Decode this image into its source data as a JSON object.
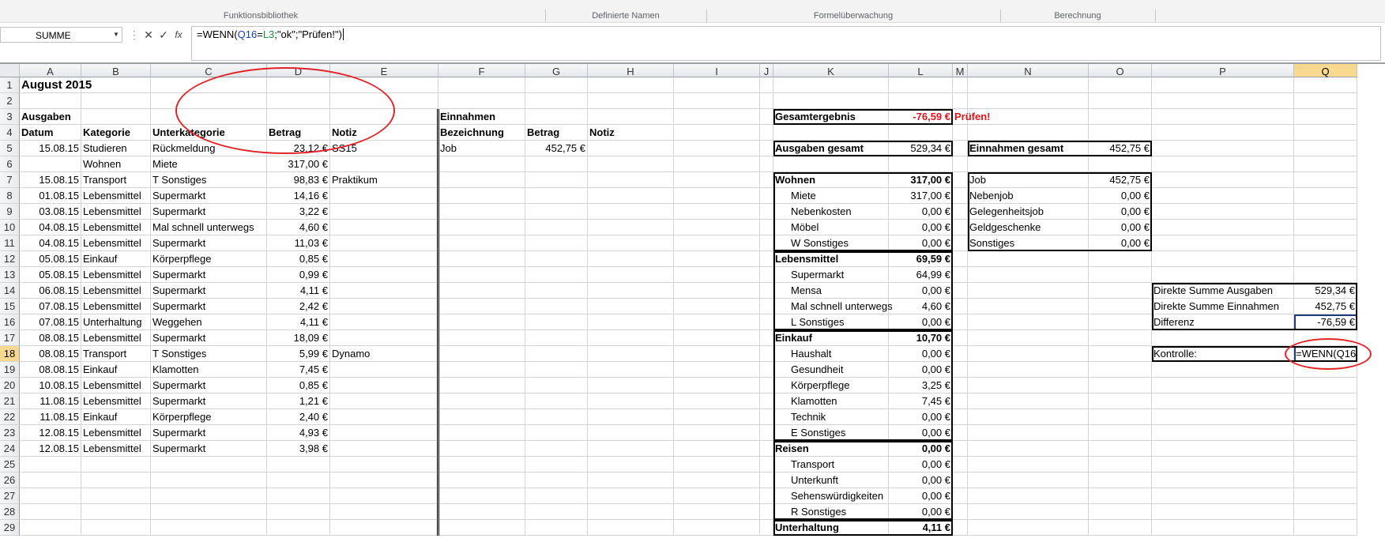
{
  "ribbon": {
    "groups": [
      "Funktionsbibliothek",
      "Definierte Namen",
      "Formelüberwachung",
      "Berechnung"
    ]
  },
  "formula_bar": {
    "name_box": "SUMME",
    "cancel_icon": "✕",
    "enter_icon": "✓",
    "fx_label": "fx",
    "formula": {
      "p1": "=WENN(",
      "ref1": "Q16",
      "eq": "=",
      "ref2": "L3",
      "p2": ";\"ok\";\"Prüfen!\")"
    }
  },
  "active_cell": "Q18",
  "columns": [
    "A",
    "B",
    "C",
    "D",
    "E",
    "F",
    "G",
    "H",
    "I",
    "J",
    "K",
    "L",
    "M",
    "N",
    "O",
    "P",
    "Q"
  ],
  "rows": [
    "1",
    "2",
    "3",
    "4",
    "5",
    "6",
    "7",
    "8",
    "9",
    "10",
    "11",
    "12",
    "13",
    "14",
    "15",
    "16",
    "17",
    "18",
    "19",
    "20",
    "21",
    "22",
    "23",
    "24",
    "25",
    "26",
    "27",
    "28",
    "29"
  ],
  "sheet": {
    "title": "August 2015",
    "expenses_title": "Ausgaben",
    "expenses_headers": [
      "Datum",
      "Kategorie",
      "Unterkategorie",
      "Betrag",
      "Notiz"
    ],
    "expenses": [
      [
        "15.08.15",
        "Studieren",
        "Rückmeldung",
        "23,12 €",
        "SS15"
      ],
      [
        "",
        "Wohnen",
        "Miete",
        "317,00 €",
        ""
      ],
      [
        "15.08.15",
        "Transport",
        "T Sonstiges",
        "98,83 €",
        "Praktikum"
      ],
      [
        "01.08.15",
        "Lebensmittel",
        "Supermarkt",
        "14,16 €",
        ""
      ],
      [
        "03.08.15",
        "Lebensmittel",
        "Supermarkt",
        "3,22 €",
        ""
      ],
      [
        "04.08.15",
        "Lebensmittel",
        "Mal schnell unterwegs",
        "4,60 €",
        ""
      ],
      [
        "04.08.15",
        "Lebensmittel",
        "Supermarkt",
        "11,03 €",
        ""
      ],
      [
        "05.08.15",
        "Einkauf",
        "Körperpflege",
        "0,85 €",
        ""
      ],
      [
        "05.08.15",
        "Lebensmittel",
        "Supermarkt",
        "0,99 €",
        ""
      ],
      [
        "06.08.15",
        "Lebensmittel",
        "Supermarkt",
        "4,11 €",
        ""
      ],
      [
        "07.08.15",
        "Lebensmittel",
        "Supermarkt",
        "2,42 €",
        ""
      ],
      [
        "07.08.15",
        "Unterhaltung",
        "Weggehen",
        "4,11 €",
        ""
      ],
      [
        "08.08.15",
        "Lebensmittel",
        "Supermarkt",
        "18,09 €",
        ""
      ],
      [
        "08.08.15",
        "Transport",
        "T Sonstiges",
        "5,99 €",
        "Dynamo"
      ],
      [
        "08.08.15",
        "Einkauf",
        "Klamotten",
        "7,45 €",
        ""
      ],
      [
        "10.08.15",
        "Lebensmittel",
        "Supermarkt",
        "0,85 €",
        ""
      ],
      [
        "11.08.15",
        "Lebensmittel",
        "Supermarkt",
        "1,21 €",
        ""
      ],
      [
        "11.08.15",
        "Einkauf",
        "Körperpflege",
        "2,40 €",
        ""
      ],
      [
        "12.08.15",
        "Lebensmittel",
        "Supermarkt",
        "4,93 €",
        ""
      ],
      [
        "12.08.15",
        "Lebensmittel",
        "Supermarkt",
        "3,98 €",
        ""
      ]
    ],
    "income_title": "Einnahmen",
    "income_headers": [
      "Bezeichnung",
      "Betrag",
      "Notiz"
    ],
    "income": [
      [
        "Job",
        "452,75 €",
        ""
      ]
    ],
    "gesamtergebnis": {
      "label": "Gesamtergebnis",
      "value": "-76,59 €",
      "check": "Prüfen!"
    },
    "ausgaben_gesamt": {
      "label": "Ausgaben gesamt",
      "value": "529,34 €"
    },
    "einnahmen_gesamt": {
      "label": "Einnahmen gesamt",
      "value": "452,75 €"
    },
    "categories": [
      {
        "label": "Wohnen",
        "value": "317,00 €",
        "bold": true
      },
      {
        "label": "Miete",
        "value": "317,00 €"
      },
      {
        "label": "Nebenkosten",
        "value": "0,00 €"
      },
      {
        "label": "Möbel",
        "value": "0,00 €"
      },
      {
        "label": "W Sonstiges",
        "value": "0,00 €"
      },
      {
        "label": "Lebensmittel",
        "value": "69,59 €",
        "bold": true
      },
      {
        "label": "Supermarkt",
        "value": "64,99 €"
      },
      {
        "label": "Mensa",
        "value": "0,00 €"
      },
      {
        "label": "Mal schnell unterwegs",
        "value": "4,60 €"
      },
      {
        "label": "L Sonstiges",
        "value": "0,00 €"
      },
      {
        "label": "Einkauf",
        "value": "10,70 €",
        "bold": true
      },
      {
        "label": "Haushalt",
        "value": "0,00 €"
      },
      {
        "label": "Gesundheit",
        "value": "0,00 €"
      },
      {
        "label": "Körperpflege",
        "value": "3,25 €"
      },
      {
        "label": "Klamotten",
        "value": "7,45 €"
      },
      {
        "label": "Technik",
        "value": "0,00 €"
      },
      {
        "label": "E Sonstiges",
        "value": "0,00 €"
      },
      {
        "label": "Reisen",
        "value": "0,00 €",
        "bold": true
      },
      {
        "label": "Transport",
        "value": "0,00 €"
      },
      {
        "label": "Unterkunft",
        "value": "0,00 €"
      },
      {
        "label": "Sehenswürdigkeiten",
        "value": "0,00 €"
      },
      {
        "label": "R Sonstiges",
        "value": "0,00 €"
      },
      {
        "label": "Unterhaltung",
        "value": "4,11 €",
        "bold": true
      }
    ],
    "income_breakdown": [
      {
        "label": "Job",
        "value": "452,75 €"
      },
      {
        "label": "Nebenjob",
        "value": "0,00 €"
      },
      {
        "label": "Gelegenheitsjob",
        "value": "0,00 €"
      },
      {
        "label": "Geldgeschenke",
        "value": "0,00 €"
      },
      {
        "label": "Sonstiges",
        "value": "0,00 €"
      }
    ],
    "check_box": [
      {
        "label": "Direkte Summe Ausgaben",
        "value": "529,34 €"
      },
      {
        "label": "Direkte Summe Einnahmen",
        "value": "452,75 €"
      },
      {
        "label": "Differenz",
        "value": "-76,59 €"
      }
    ],
    "kontrolle": {
      "label": "Kontrolle:",
      "value": "=WENN(Q16"
    }
  }
}
